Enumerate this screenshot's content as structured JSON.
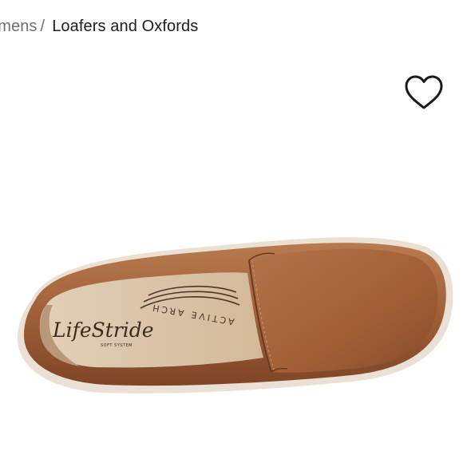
{
  "breadcrumb": {
    "parent_label": "omens",
    "separator": "/",
    "current_label": "Loafers and Oxfords"
  },
  "wishlist": {
    "icon": "heart-outline-icon",
    "color": "#1a1a1a"
  },
  "product_image": {
    "brand_text": "LifeStride",
    "brand_subtext": "SOFT SYSTEM",
    "insole_text": "ACTIVE ARCH",
    "leather_color": "#a4623a",
    "lining_color": "#d9c3a8",
    "sole_color": "#e8dccf"
  }
}
